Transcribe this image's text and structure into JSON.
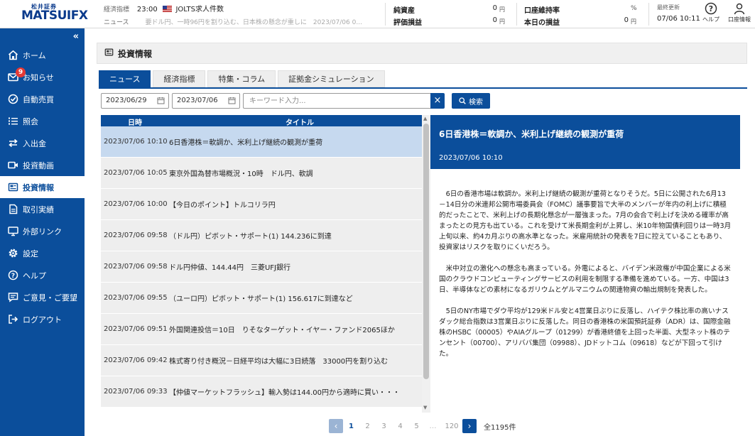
{
  "app": {
    "logo_small": "松井証券",
    "logo_main": "MATSUI",
    "logo_fx": "FX"
  },
  "ticker": {
    "label_econ": "経済指標",
    "time": "23:00",
    "event": "JOLTS求人件数",
    "label_news": "ニュース",
    "scroll_text": "要ドル円、一時96円を割り込む、日本株の懸念が重しに　2023/07/06 0..."
  },
  "account": {
    "net_assets_label": "純資産",
    "net_assets_value": "0",
    "net_assets_unit": "円",
    "valuation_label": "評価損益",
    "valuation_value": "0",
    "valuation_unit": "円",
    "maintenance_label": "口座維持率",
    "maintenance_unit": "%",
    "today_pl_label": "本日の損益",
    "today_pl_value": "0",
    "today_pl_unit": "円",
    "updated_label": "最終更新",
    "updated_time": "07/06 10:11"
  },
  "header_icons": {
    "help": "ヘルプ",
    "account_info": "口座情報"
  },
  "sidebar": {
    "collapse": "«",
    "items": [
      {
        "label": "ホーム"
      },
      {
        "label": "お知らせ",
        "badge": "9"
      },
      {
        "label": "自動売買"
      },
      {
        "label": "照会"
      },
      {
        "label": "入出金"
      },
      {
        "label": "投資動画"
      },
      {
        "label": "投資情報"
      },
      {
        "label": "取引実績"
      },
      {
        "label": "外部リンク"
      },
      {
        "label": "設定"
      },
      {
        "label": "ヘルプ"
      },
      {
        "label": "ご意見・ご要望"
      },
      {
        "label": "ログアウト"
      }
    ]
  },
  "page": {
    "title": "投資情報",
    "tabs": [
      "ニュース",
      "経済指標",
      "特集・コラム",
      "証拠金シミュレーション"
    ]
  },
  "filters": {
    "date_from": "2023/06/29",
    "date_to": "2023/07/06",
    "keyword_placeholder": "キーワード入力...",
    "clear": "×",
    "search_label": "検索"
  },
  "news_list": {
    "col_date": "日時",
    "col_title": "タイトル",
    "rows": [
      {
        "date": "2023/07/06 10:10",
        "title": "6日香港株＝軟調か、米利上げ継続の観測が重荷"
      },
      {
        "date": "2023/07/06 10:05",
        "title": "東京外国為替市場概況・10時　ドル円、軟調"
      },
      {
        "date": "2023/07/06 10:00",
        "title": "【今日のポイント】トルコリラ円"
      },
      {
        "date": "2023/07/06 09:58",
        "title": "（ドル円）ピボット・サポート(1) 144.236に到達"
      },
      {
        "date": "2023/07/06 09:58",
        "title": "ドル円仲値、144.44円　三菱UFJ銀行"
      },
      {
        "date": "2023/07/06 09:55",
        "title": "（ユーロ円）ピボット・サポート(1) 156.617に到達など"
      },
      {
        "date": "2023/07/06 09:51",
        "title": "外国関連投信＝10日　りそなターゲット・イヤー・ファンド2065ほか"
      },
      {
        "date": "2023/07/06 09:42",
        "title": "株式寄り付き概況－日経平均は大幅に3日続落　33000円を割り込む"
      },
      {
        "date": "2023/07/06 09:33",
        "title": "【仲値マーケットフラッシュ】輸入勢は144.00円から適時に買い・・・"
      }
    ]
  },
  "detail": {
    "title": "6日香港株＝軟調か、米利上げ継続の観測が重荷",
    "date": "2023/07/06 10:10",
    "paragraphs": [
      "6日の香港市場は軟調か。米利上げ継続の観測が重荷となりそうだ。5日に公開された6月13－14日分の米連邦公開市場委員会（FOMC）議事要旨で大半のメンバーが年内の利上げに積極的だったことで、米利上げの長期化懸念が一層強まった。7月の会合で利上げを決める確率が高まったとの見方も出ている。これを受けて米長期金利が上昇し、米10年物国債利回りは一時3月上旬以来、約4カ月ぶりの高水準となった。米雇用統計の発表を7日に控えていることもあり、投資家はリスクを取りにくいだろう。",
      "米中対立の激化への懸念も高まっている。外電によると、バイデン米政権が中国企業による米国のクラウドコンピューティングサービスの利用を制限する準備を進めている。一方、中国は3日、半導体などの素材になるガリウムとゲルマニウムの関連物資の輸出規制を発表した。",
      "5日のNY市場でダウ平均が129米ドル安と4営業日ぶりに反落し、ハイテク株比率の高いナスダック総合指数は3営業日ぶりに反落した。同日の香港株の米国預託証券（ADR）は、国際金融株のHSBC（00005）やAIAグループ（01299）が香港終値を上回った半面、大型ネット株のテンセント（00700）、アリババ集団（09988）、JDドットコム（09618）などが下回って引けた。"
    ]
  },
  "pagination": {
    "pages": [
      "1",
      "2",
      "3",
      "4",
      "5"
    ],
    "ellipsis": "…",
    "last": "120",
    "total": "全1195件"
  },
  "colors": {
    "brand": "#0b4e9b",
    "badge": "#e53935",
    "row_selected": "#c6d9ef"
  }
}
